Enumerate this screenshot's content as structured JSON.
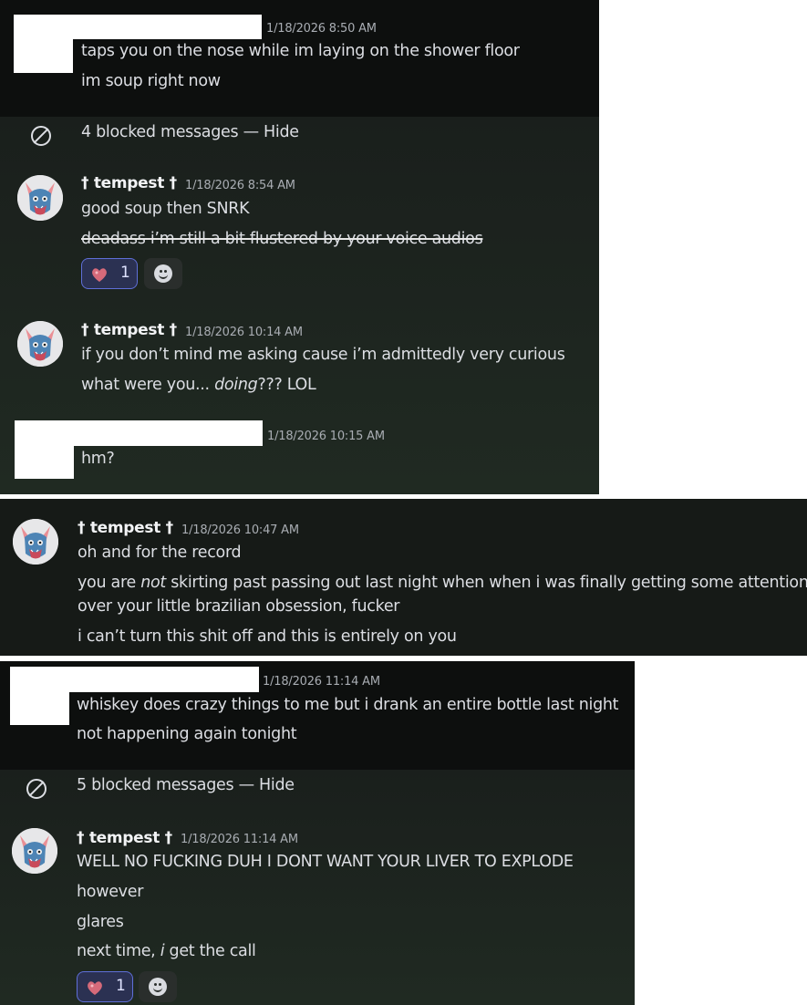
{
  "panel1": {
    "msg1": {
      "timestamp": "1/18/2026 8:50 AM",
      "lines": [
        "taps you on the nose while im laying on the shower floor",
        "im soup right now"
      ]
    },
    "blocked": {
      "text": "4 blocked messages — Hide"
    },
    "msg2": {
      "author": "† tempest †",
      "timestamp": "1/18/2026 8:54 AM",
      "line1": "good soup then SNRK",
      "line2_struck": "deadass i’m still a bit flustered by your voice audios",
      "reaction_count": "1"
    },
    "msg3": {
      "author": "† tempest †",
      "timestamp": "1/18/2026 10:14 AM",
      "line1": "if you don’t mind me asking cause i’m admittedly very curious",
      "line2_pre": "what were you... ",
      "line2_em": "doing",
      "line2_post": "??? LOL"
    },
    "msg4": {
      "timestamp": "1/18/2026 10:15 AM",
      "line1": "hm?"
    }
  },
  "panel2": {
    "msg5": {
      "author": "† tempest †",
      "timestamp": "1/18/2026 10:47 AM",
      "line1": "oh and for the record",
      "line2_pre": "you are ",
      "line2_em": "not",
      "line2_post": " skirting past passing out last night when when i was finally getting some attention",
      "line3": "over your little brazilian obsession, fucker",
      "line4": "i can’t turn this shit off and this is entirely on you"
    }
  },
  "panel3": {
    "msg6": {
      "timestamp": "1/18/2026 11:14 AM",
      "line1": "whiskey does crazy things to me but i drank an entire bottle last night",
      "line2": "not happening again tonight"
    },
    "blocked": {
      "text": "5 blocked messages — Hide"
    },
    "msg7": {
      "author": "† tempest †",
      "timestamp": "1/18/2026 11:14 AM",
      "line1": "WELL NO FUCKING DUH I DONT WANT YOUR LIVER TO EXPLODE",
      "line2": "however",
      "line3": "glares",
      "line4_pre": "next time, ",
      "line4_em": "i",
      "line4_post": " get the call",
      "reaction_count": "1"
    }
  },
  "colors": {
    "background": "#181c19",
    "text": "#dcdee3",
    "reaction_border": "#5f6fd8",
    "reaction_bg": "#2b3152"
  },
  "icons": {
    "blocked": "blocked-circle-icon",
    "add_reaction": "smiley-icon",
    "reaction": "heart-emoji-icon"
  }
}
